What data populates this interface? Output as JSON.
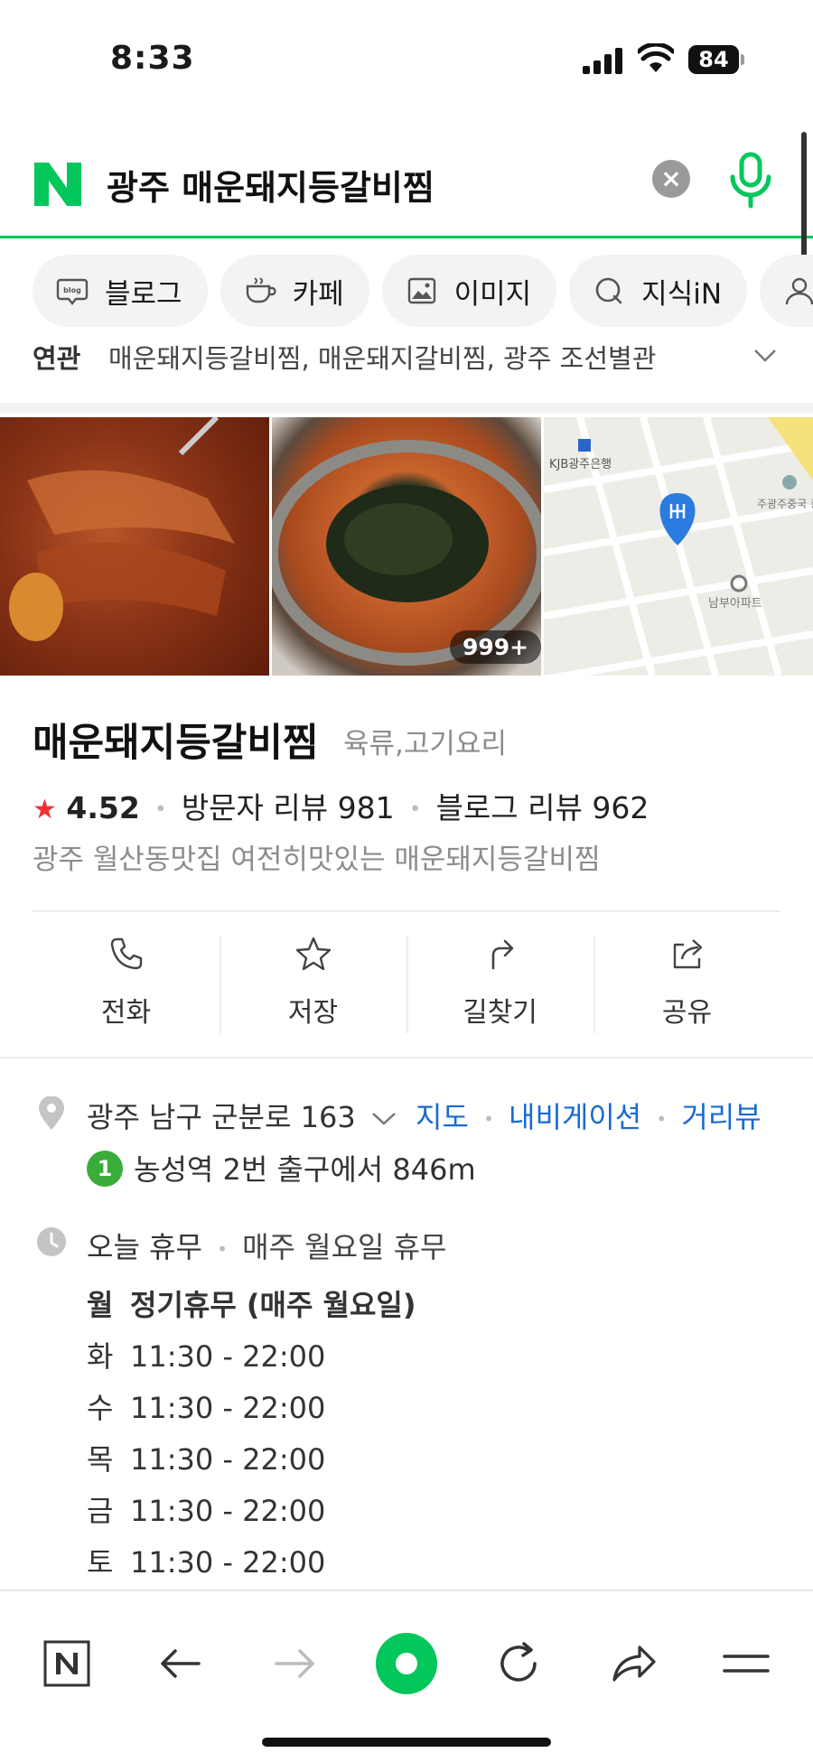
{
  "status_bar": {
    "time": "8:33",
    "battery": "84"
  },
  "search": {
    "query": "광주 매운돼지등갈비찜"
  },
  "chips": [
    {
      "icon": "blog-icon",
      "label": "블로그"
    },
    {
      "icon": "cafe-icon",
      "label": "카페"
    },
    {
      "icon": "image-icon",
      "label": "이미지"
    },
    {
      "icon": "kin-icon",
      "label": "지식iN"
    }
  ],
  "related": {
    "label": "연관",
    "text": "매운돼지등갈비찜, 매운돼지갈비찜, 광주 조선별관"
  },
  "photos": {
    "count_badge": "999+",
    "map": {
      "bank_label": "KJB광주은행",
      "building_label": "주광주중국 총영사관",
      "apt_label": "남부아파트"
    }
  },
  "place": {
    "name": "매운돼지등갈비찜",
    "category": "육류,고기요리",
    "rating": "4.52",
    "visitor_reviews": "방문자 리뷰 981",
    "blog_reviews": "블로그 리뷰 962",
    "description": "광주 월산동맛집 여전히맛있는 매운돼지등갈비찜"
  },
  "actions": [
    {
      "icon": "phone-icon",
      "label": "전화"
    },
    {
      "icon": "star-icon",
      "label": "저장"
    },
    {
      "icon": "directions-icon",
      "label": "길찾기"
    },
    {
      "icon": "share-icon",
      "label": "공유"
    }
  ],
  "address": {
    "text": "광주 남구 군분로 163",
    "links": [
      "지도",
      "내비게이션",
      "거리뷰"
    ],
    "subway_line": "1",
    "subway_text": "농성역 2번 출구에서 846m"
  },
  "hours": {
    "status": "오늘 휴무",
    "note": "매주 월요일 휴무",
    "rows": [
      {
        "day": "월",
        "time": "정기휴무 (매주 월요일)"
      },
      {
        "day": "화",
        "time": "11:30 - 22:00"
      },
      {
        "day": "수",
        "time": "11:30 - 22:00"
      },
      {
        "day": "목",
        "time": "11:30 - 22:00"
      },
      {
        "day": "금",
        "time": "11:30 - 22:00"
      },
      {
        "day": "토",
        "time": "11:30 - 22:00"
      }
    ]
  },
  "colors": {
    "accent": "#03c75a",
    "link": "#1a6ad3",
    "star": "#ee3333"
  }
}
